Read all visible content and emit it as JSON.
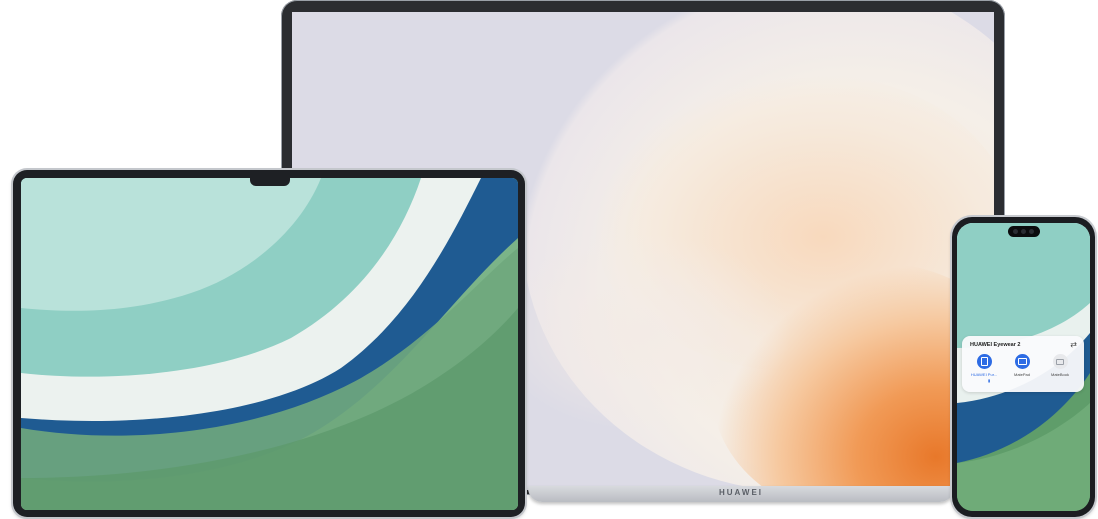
{
  "laptop": {
    "brand": "HUAWEI",
    "wallpaper_colors": {
      "background": "#dcdbe6",
      "petal_light": "#f2ede6",
      "petal_peach": "#f4cfb0",
      "petal_orange": "#ec8a3a"
    }
  },
  "tablet": {
    "wallpaper_colors": {
      "teal": "#8fcfc4",
      "white": "#eef3f1",
      "blue": "#1f5b92",
      "green": "#6fa77d"
    }
  },
  "phone": {
    "audio_card": {
      "title": "HUAWEI Eyewear 2",
      "swap_icon": "swap-arrows-icon",
      "devices": [
        {
          "label": "HUAWEI Pur...",
          "icon": "phone-icon",
          "active": true
        },
        {
          "label": "MatePad",
          "icon": "tablet-icon",
          "active": true
        },
        {
          "label": "MateBook",
          "icon": "laptop-icon",
          "active": false
        }
      ]
    }
  }
}
